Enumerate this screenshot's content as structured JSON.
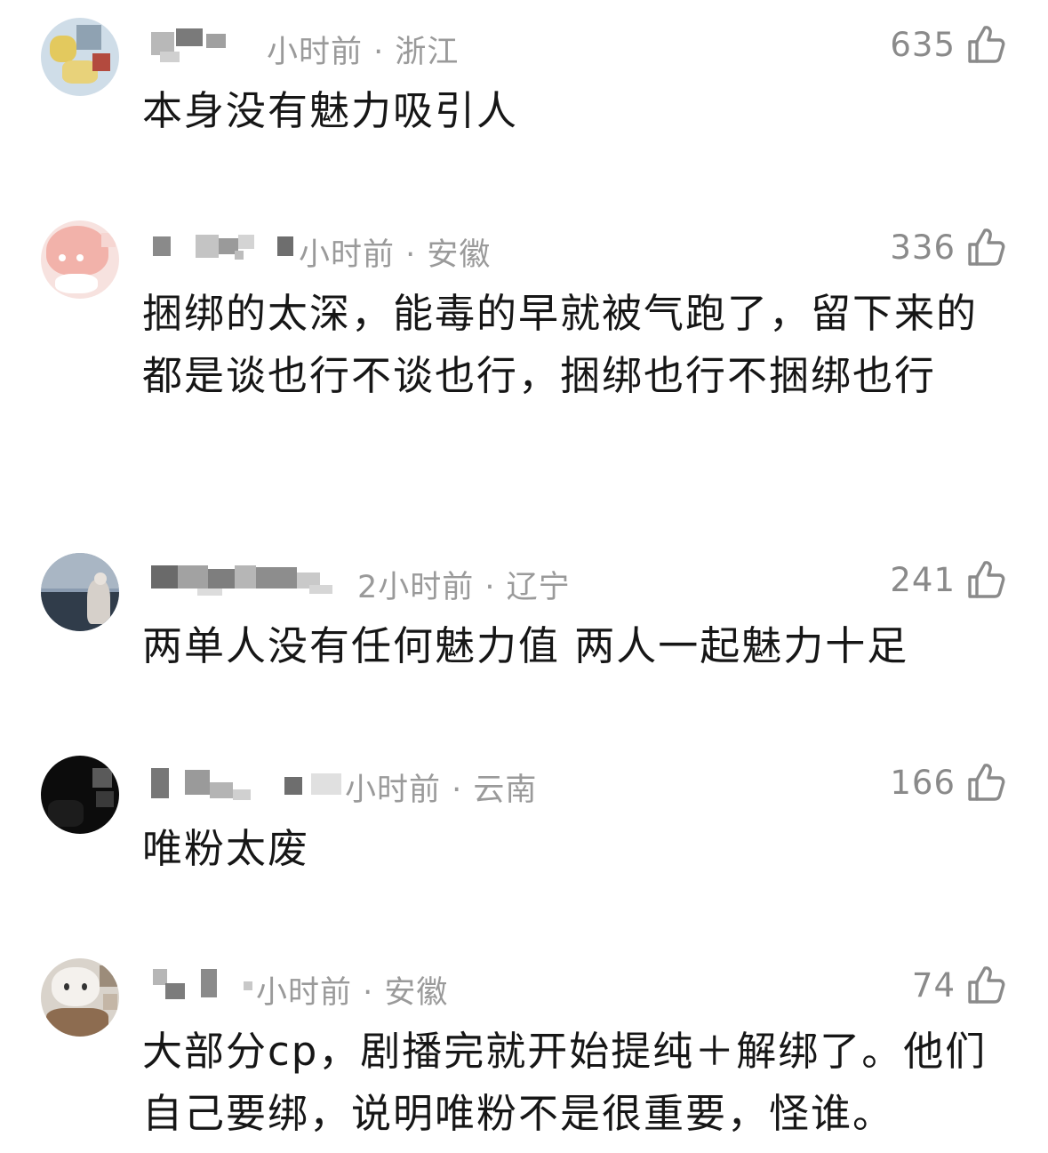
{
  "comments": [
    {
      "meta": "小时前 · 浙江",
      "likes": "635",
      "text": "本身没有魅力吸引人",
      "avatar_icon": "avatar-pikachu",
      "avatar_colors": [
        "#bcd3e2",
        "#e6cf6a",
        "#7a8ea0",
        "#d9e6ee"
      ]
    },
    {
      "meta": "小时前 · 安徽",
      "likes": "336",
      "text": "捆绑的太深，能毒的早就被气跑了，留下来的都是谈也行不谈也行，捆绑也行不捆绑也行",
      "avatar_icon": "avatar-peach",
      "avatar_colors": [
        "#f4d3cf",
        "#f0a7a0",
        "#ffffff",
        "#f8e4e1"
      ]
    },
    {
      "meta": "2小时前 · 辽宁",
      "likes": "241",
      "text": "两单人没有任何魅力值 两人一起魅力十足",
      "avatar_icon": "avatar-seaside",
      "avatar_colors": [
        "#7d8fa3",
        "#2f3b4a",
        "#c9c4bf",
        "#9aa9b8"
      ]
    },
    {
      "meta": "小时前 · 云南",
      "likes": "166",
      "text": "唯粉太废",
      "avatar_icon": "avatar-dark",
      "avatar_colors": [
        "#121212",
        "#2b2b2b",
        "#5a5a5a",
        "#0a0a0a"
      ]
    },
    {
      "meta": "小时前 · 安徽",
      "likes": "74",
      "text": "大部分cp，剧播完就开始提纯＋解绑了。他们自己要绑，说明唯粉不是很重要，怪谁。",
      "avatar_icon": "avatar-kitty",
      "avatar_colors": [
        "#d8d2ca",
        "#8a6a4e",
        "#f3f0ec",
        "#b9a48e"
      ]
    }
  ],
  "icons": {
    "like": "thumbs-up-icon"
  },
  "colors": {
    "meta": "#9a9a9a",
    "likes": "#8a8a8a",
    "text": "#161616"
  }
}
